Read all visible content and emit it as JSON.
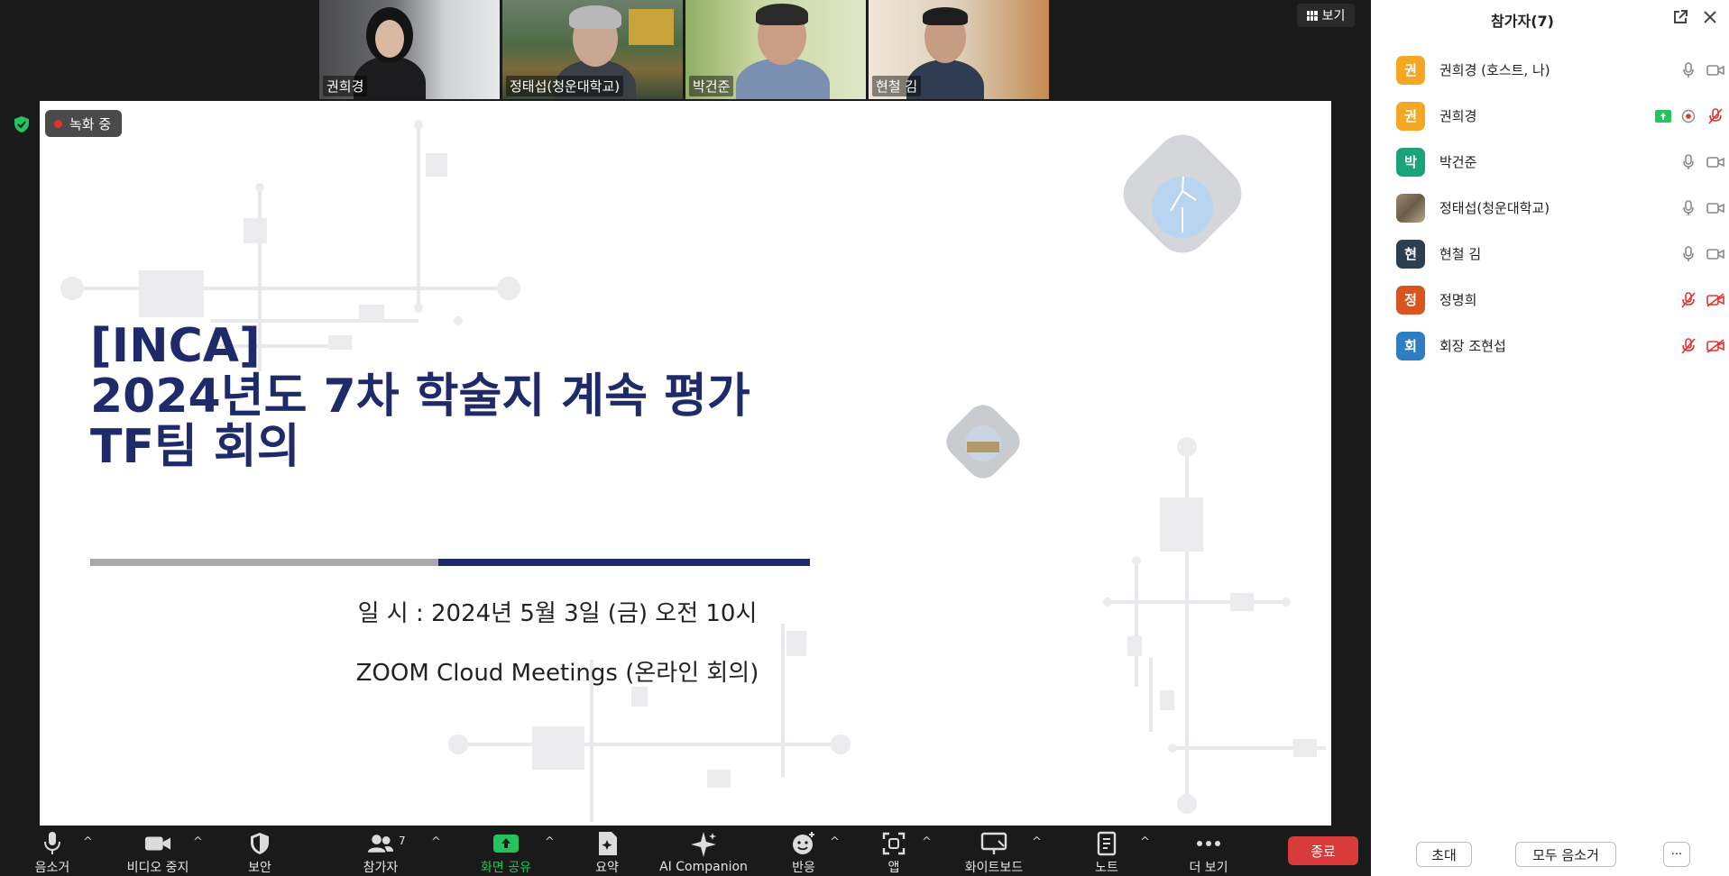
{
  "video_tiles": [
    {
      "name": "권희경",
      "speaking": false
    },
    {
      "name": "정태섭(청운대학교)",
      "speaking": false
    },
    {
      "name": "박건준",
      "speaking": true
    },
    {
      "name": "현철 김",
      "speaking": false
    }
  ],
  "view_button": {
    "label": "보기",
    "icon": "grid-view-icon"
  },
  "recording": {
    "label": "녹화 중",
    "color": "#e8302a"
  },
  "slide": {
    "title_lines": [
      "[INCA]",
      "2024년도 7차 학술지 계속 평가",
      "TF팀 회의"
    ],
    "title_color": "#1f2a6b",
    "datetime": "일 시 : 2024년 5월 3일 (금) 오전 10시",
    "platform": "ZOOM Cloud Meetings (온라인 회의)",
    "bar_colors": [
      "#a8a8aa",
      "#1f2a6b"
    ]
  },
  "toolbar": {
    "items": [
      {
        "id": "audio",
        "label": "음소거",
        "icon": "microphone-icon",
        "caret": true
      },
      {
        "id": "video",
        "label": "비디오 중지",
        "icon": "video-camera-icon",
        "caret": true
      },
      {
        "id": "security",
        "label": "보안",
        "icon": "shield-icon",
        "caret": false
      },
      {
        "id": "participants",
        "label": "참가자",
        "icon": "participants-icon",
        "count": "7",
        "caret": true
      },
      {
        "id": "share",
        "label": "화면 공유",
        "icon": "share-screen-icon",
        "caret": true
      },
      {
        "id": "summary",
        "label": "요약",
        "icon": "summary-icon",
        "caret": false
      },
      {
        "id": "ai",
        "label": "AI Companion",
        "icon": "sparkle-icon",
        "caret": false
      },
      {
        "id": "reactions",
        "label": "반응",
        "icon": "reaction-icon",
        "caret": true
      },
      {
        "id": "apps",
        "label": "앱",
        "icon": "apps-icon",
        "caret": true
      },
      {
        "id": "whiteboard",
        "label": "화이트보드",
        "icon": "whiteboard-icon",
        "caret": true
      },
      {
        "id": "notes",
        "label": "노트",
        "icon": "notes-icon",
        "caret": true
      },
      {
        "id": "more",
        "label": "더 보기",
        "icon": "more-icon",
        "caret": false
      }
    ],
    "end_label": "종료",
    "accent_green": "#23c45e",
    "end_color": "#d93a3a"
  },
  "panel": {
    "title": "참가자(7)",
    "participants": [
      {
        "initial": "권",
        "name": "권희경 (호스트, 나)",
        "avatar_color": "#f5a623",
        "mic": "on",
        "video": "on",
        "sharing": false,
        "recording": false
      },
      {
        "initial": "권",
        "name": "권희경",
        "avatar_color": "#f5a623",
        "mic": "muted",
        "video": "none",
        "sharing": true,
        "recording": true
      },
      {
        "initial": "박",
        "name": "박건준",
        "avatar_color": "#1aa37a",
        "mic": "on",
        "video": "on",
        "sharing": false,
        "recording": false
      },
      {
        "initial": "",
        "name": "정태섭(청운대학교)",
        "avatar_color": "#8a7a66",
        "mic": "on",
        "video": "on",
        "sharing": false,
        "recording": false
      },
      {
        "initial": "현",
        "name": "현철 김",
        "avatar_color": "#2c3e50",
        "mic": "on",
        "video": "on",
        "sharing": false,
        "recording": false
      },
      {
        "initial": "정",
        "name": "정명희",
        "avatar_color": "#d9541e",
        "mic": "muted",
        "video": "off",
        "sharing": false,
        "recording": false
      },
      {
        "initial": "회",
        "name": "회장 조현섭",
        "avatar_color": "#2f7ec2",
        "mic": "muted",
        "video": "off",
        "sharing": false,
        "recording": false
      }
    ],
    "footer": {
      "invite": "초대",
      "mute_all": "모두 음소거",
      "more": "···"
    }
  }
}
